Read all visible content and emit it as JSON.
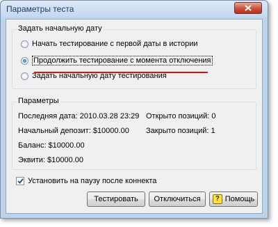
{
  "window": {
    "title": "Параметры теста",
    "close_label": "close"
  },
  "start_group": {
    "title": "Задать начальную дату",
    "options": [
      {
        "label": "Начать тестирование с первой даты в истории",
        "checked": false
      },
      {
        "label": "Продолжить тестирование с момента отключения",
        "checked": true
      },
      {
        "label": "Задать начальную дату тестирования",
        "checked": false
      }
    ]
  },
  "params_group": {
    "title": "Параметры",
    "last_date": "Последняя дата: 2010.03.28 23:29",
    "open_positions": "Открыто позиций: 0",
    "initial_deposit": "Начальный депозит: $10000.00",
    "closed_positions": "Закрыто позиций: 1",
    "balance": "Баланс: $10000.00",
    "equity": "Эквити: $10000.00"
  },
  "pause_checkbox": {
    "label": "Установить на паузу после коннекта",
    "checked": true
  },
  "buttons": {
    "test": "Тестировать",
    "disconnect": "Отключиться",
    "help": "Помощь"
  },
  "colors": {
    "accent_underline": "#e01010",
    "frame": "#bcd3ec"
  }
}
